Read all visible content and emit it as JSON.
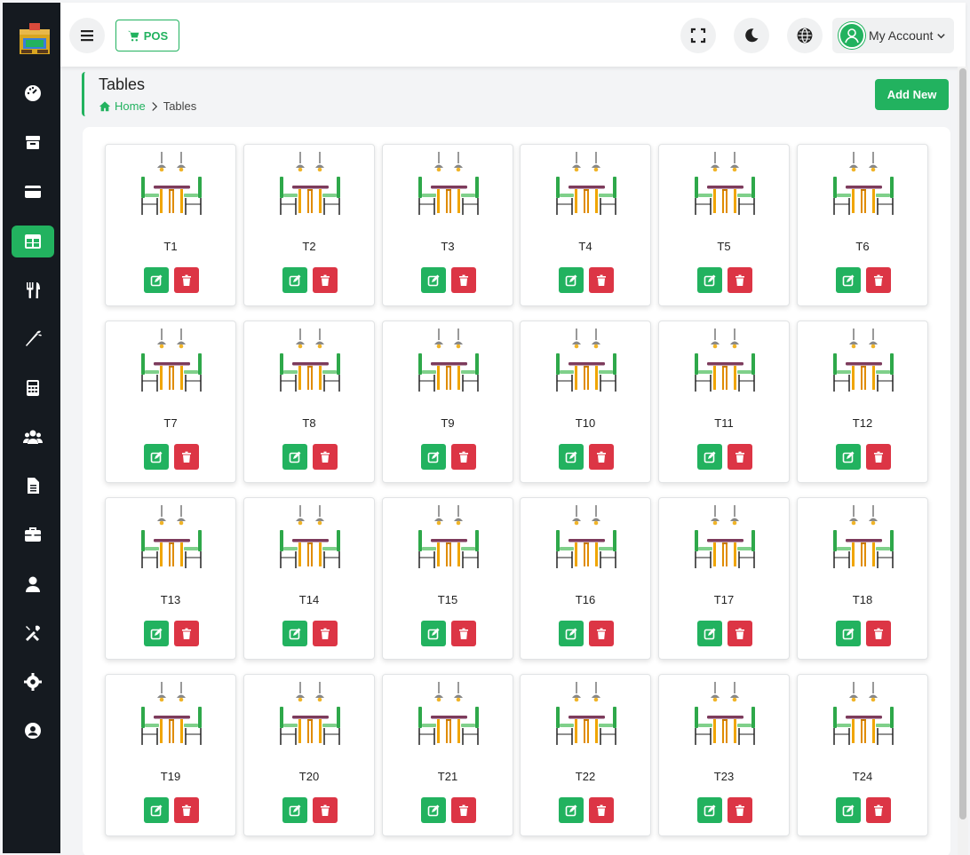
{
  "topbar": {
    "pos_label": "POS",
    "account_label": "My Account"
  },
  "sidebar": {
    "items": [
      {
        "icon": "dashboard-icon",
        "active": false
      },
      {
        "icon": "box-icon",
        "active": false
      },
      {
        "icon": "credit-card-icon",
        "active": false
      },
      {
        "icon": "table-icon",
        "active": true
      },
      {
        "icon": "utensils-icon",
        "active": false
      },
      {
        "icon": "carrot-icon",
        "active": false
      },
      {
        "icon": "calculator-icon",
        "active": false
      },
      {
        "icon": "users-icon",
        "active": false
      },
      {
        "icon": "file-icon",
        "active": false
      },
      {
        "icon": "briefcase-icon",
        "active": false
      },
      {
        "icon": "user-icon",
        "active": false
      },
      {
        "icon": "tools-icon",
        "active": false
      },
      {
        "icon": "gear-icon",
        "active": false
      },
      {
        "icon": "user-circle-icon",
        "active": false
      }
    ]
  },
  "page": {
    "title": "Tables",
    "breadcrumb_home": "Home",
    "breadcrumb_current": "Tables",
    "add_new_label": "Add New"
  },
  "tables": [
    "T1",
    "T2",
    "T3",
    "T4",
    "T5",
    "T6",
    "T7",
    "T8",
    "T9",
    "T10",
    "T11",
    "T12",
    "T13",
    "T14",
    "T15",
    "T16",
    "T17",
    "T18",
    "T19",
    "T20",
    "T21",
    "T22",
    "T23",
    "T24"
  ],
  "colors": {
    "accent": "#22b25f",
    "danger": "#dc3545",
    "sidebar_bg": "#151a20"
  }
}
